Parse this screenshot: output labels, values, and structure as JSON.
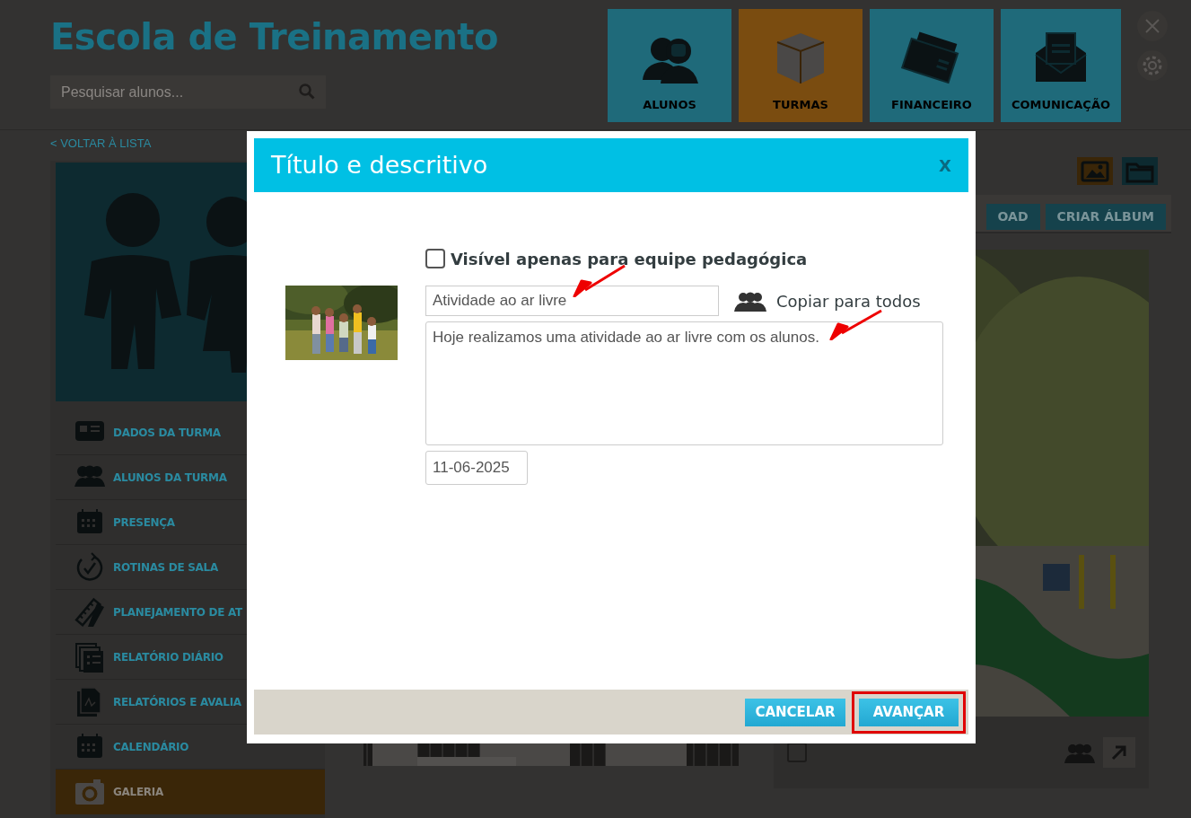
{
  "header": {
    "title": "Escola de Treinamento",
    "search": {
      "placeholder": "Pesquisar alunos..."
    }
  },
  "modules": [
    {
      "label": "ALUNOS",
      "selected": false
    },
    {
      "label": "TURMAS",
      "selected": true
    },
    {
      "label": "FINANCEIRO",
      "selected": false
    },
    {
      "label": "COMUNICAÇÃO",
      "selected": false
    }
  ],
  "back_link": "< VOLTAR À LISTA",
  "sidebar": {
    "items": [
      {
        "label": "DADOS DA TURMA",
        "selected": false
      },
      {
        "label": "ALUNOS DA TURMA",
        "selected": false
      },
      {
        "label": "PRESENÇA",
        "selected": false
      },
      {
        "label": "ROTINAS DE SALA",
        "selected": false
      },
      {
        "label": "PLANEJAMENTO DE AT",
        "selected": false
      },
      {
        "label": "RELATÓRIO DIÁRIO",
        "selected": false
      },
      {
        "label": "RELATÓRIOS E AVALIA",
        "selected": false
      },
      {
        "label": "CALENDÁRIO",
        "selected": false
      },
      {
        "label": "GALERIA",
        "selected": true
      }
    ]
  },
  "gallery": {
    "view_toggle": [
      {
        "selected": true
      },
      {
        "selected": false
      }
    ],
    "buttons": [
      "OAD",
      "CRIAR ÁLBUM"
    ],
    "photo_card": {
      "checked": false
    }
  },
  "dialog": {
    "title": "Título e descritivo",
    "close": "X",
    "visibility": {
      "label": "Visível apenas para equipe pedagógica",
      "checked": false
    },
    "photo_title": "Atividade ao ar livre",
    "copy_all": "Copiar para todos",
    "description": "Hoje realizamos uma atividade ao ar livre com os alunos.",
    "date": "11-06-2025",
    "buttons": [
      {
        "label": "CANCELAR",
        "highlighted": false
      },
      {
        "label": "AVANÇAR",
        "highlighted": true
      }
    ]
  }
}
